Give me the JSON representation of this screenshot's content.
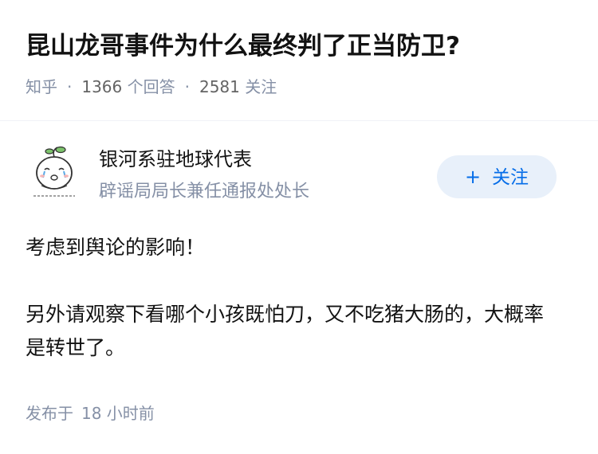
{
  "question": {
    "title": "昆山龙哥事件为什么最终判了正当防卫?",
    "source": "知乎",
    "answers_count": "1366",
    "answers_label": "个回答",
    "followers_count": "2581",
    "followers_label": "关注"
  },
  "author": {
    "name": "银河系驻地球代表",
    "bio": "辟谣局局长兼任通报处处长",
    "follow_button": "关注",
    "avatar_icon": "sprout-doll-avatar-icon"
  },
  "answer": {
    "paragraph_1": "考虑到舆论的影响！",
    "paragraph_2": "另外请观察下看哪个小孩既怕刀，又不吃猪大肠的，大概率是转世了。"
  },
  "footer": {
    "publish_label": "发布于",
    "publish_time": "18 小时前"
  },
  "colors": {
    "accent": "#056de8",
    "follow_bg": "#e8f0fa",
    "meta_gray": "#8590a6"
  }
}
